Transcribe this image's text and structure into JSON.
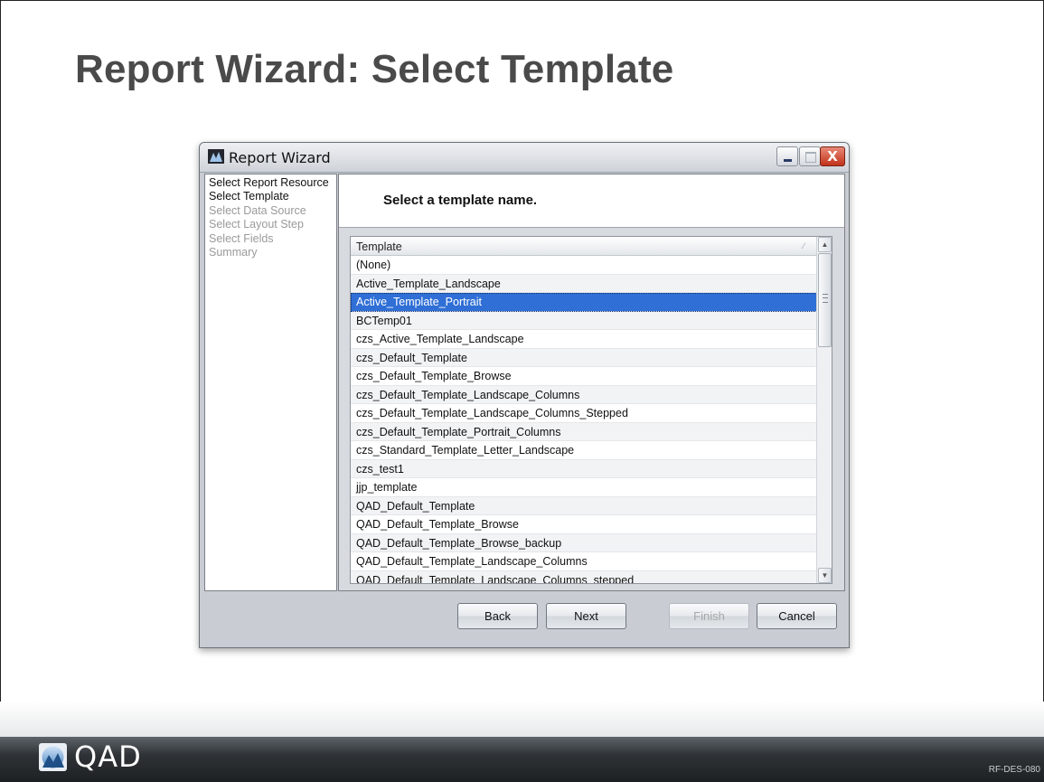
{
  "slide": {
    "title": "Report Wizard: Select Template",
    "code": "RF-DES-080"
  },
  "window": {
    "title": "Report Wizard",
    "icon": "report-wizard-app-icon",
    "controls": [
      "minimize-icon",
      "maximize-icon",
      "close-icon"
    ],
    "close_glyph": "X"
  },
  "steps": [
    {
      "label": "Select Report Resource",
      "state": "done"
    },
    {
      "label": "Select Template",
      "state": "current"
    },
    {
      "label": "Select Data Source",
      "state": "pending"
    },
    {
      "label": "Select Layout Step",
      "state": "pending"
    },
    {
      "label": "Select Fields",
      "state": "pending"
    },
    {
      "label": "Summary",
      "state": "pending"
    }
  ],
  "instruction": "Select a template name.",
  "grid": {
    "column_header": "Template",
    "sort_icon": "sort-indicator-icon",
    "selected_index": 2,
    "rows": [
      "(None)",
      "Active_Template_Landscape",
      "Active_Template_Portrait",
      "BCTemp01",
      "czs_Active_Template_Landscape",
      "czs_Default_Template",
      "czs_Default_Template_Browse",
      "czs_Default_Template_Landscape_Columns",
      "czs_Default_Template_Landscape_Columns_Stepped",
      "czs_Default_Template_Portrait_Columns",
      "czs_Standard_Template_Letter_Landscape",
      "czs_test1",
      "jjp_template",
      "QAD_Default_Template",
      "QAD_Default_Template_Browse",
      "QAD_Default_Template_Browse_backup",
      "QAD_Default_Template_Landscape_Columns",
      "QAD_Default_Template_Landscape_Columns_stepped"
    ],
    "scroll_up_glyph": "▲",
    "scroll_down_glyph": "▼"
  },
  "buttons": {
    "back": "Back",
    "next": "Next",
    "finish": "Finish",
    "cancel": "Cancel",
    "finish_enabled": false
  },
  "footer": {
    "logo_text": "QAD"
  },
  "colors": {
    "selection": "#2f6fd6",
    "title_text": "#4a4a4a",
    "footer_bg": "#1d2023"
  }
}
